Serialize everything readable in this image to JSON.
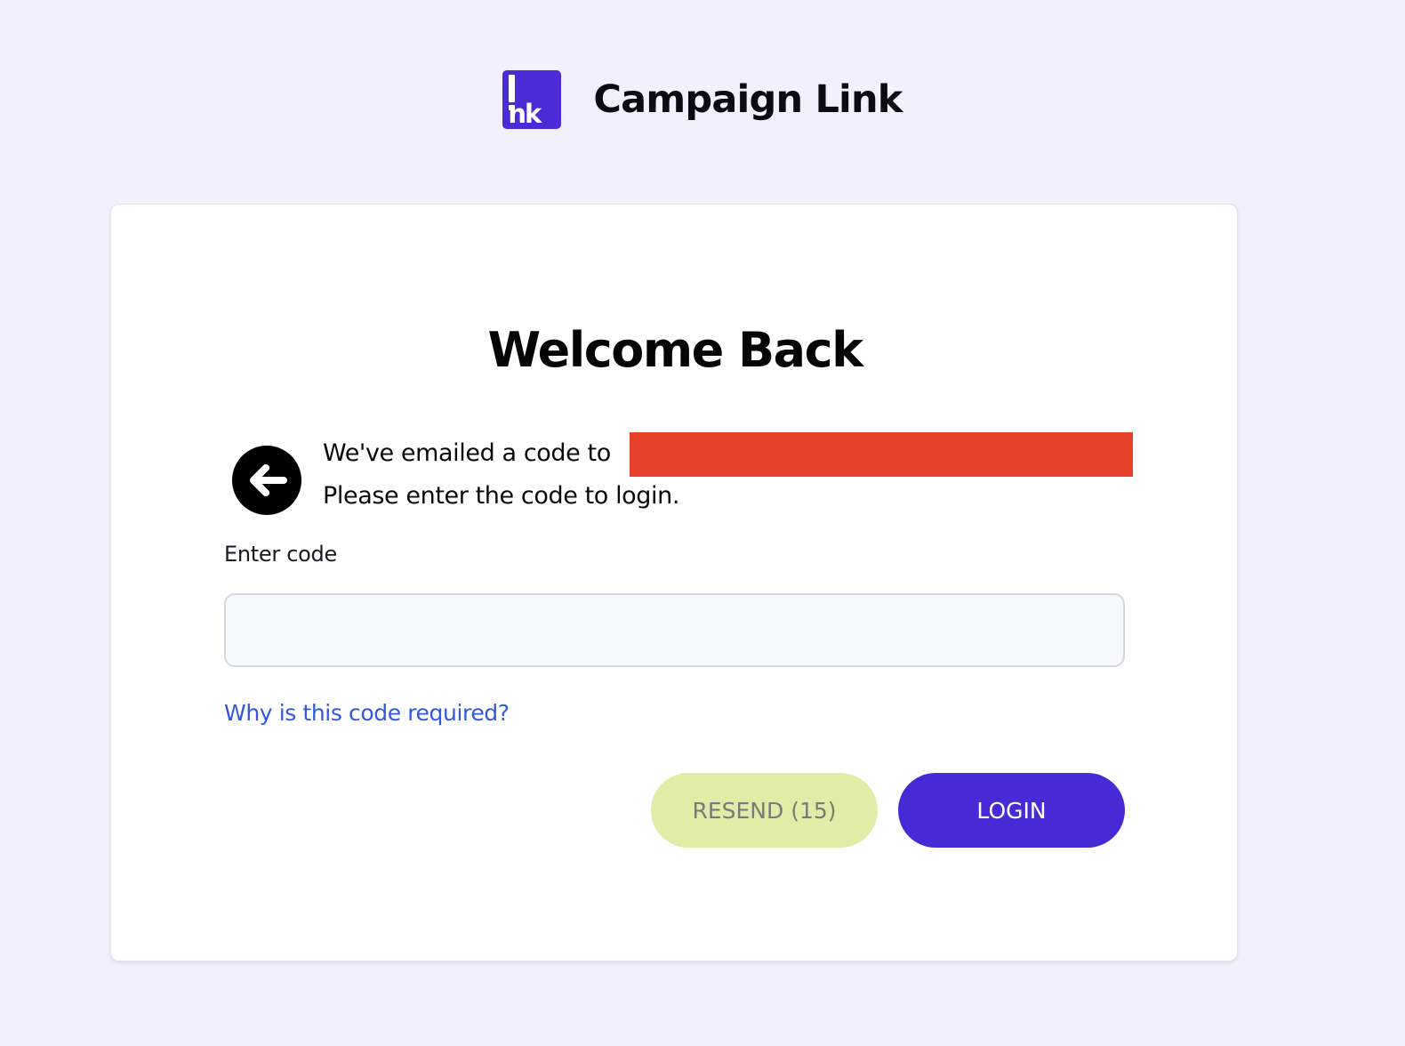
{
  "header": {
    "logo_text": "nk",
    "app_title": "Campaign Link"
  },
  "card": {
    "heading": "Welcome Back",
    "message_line1": "We've emailed a code to",
    "message_line2": "Please enter the code to login.",
    "code_label": "Enter code",
    "code_value": "",
    "why_link": "Why is this code required?",
    "resend_label": "RESEND (15)",
    "login_label": "LOGIN"
  },
  "colors": {
    "background": "#f2f0fd",
    "brand": "#4a2bd6",
    "link": "#2f57e0",
    "resend_bg": "#e1eca7",
    "redaction": "#e8412a"
  },
  "icons": {
    "logo": "link-logo-icon",
    "back": "arrow-left-circle-icon"
  }
}
